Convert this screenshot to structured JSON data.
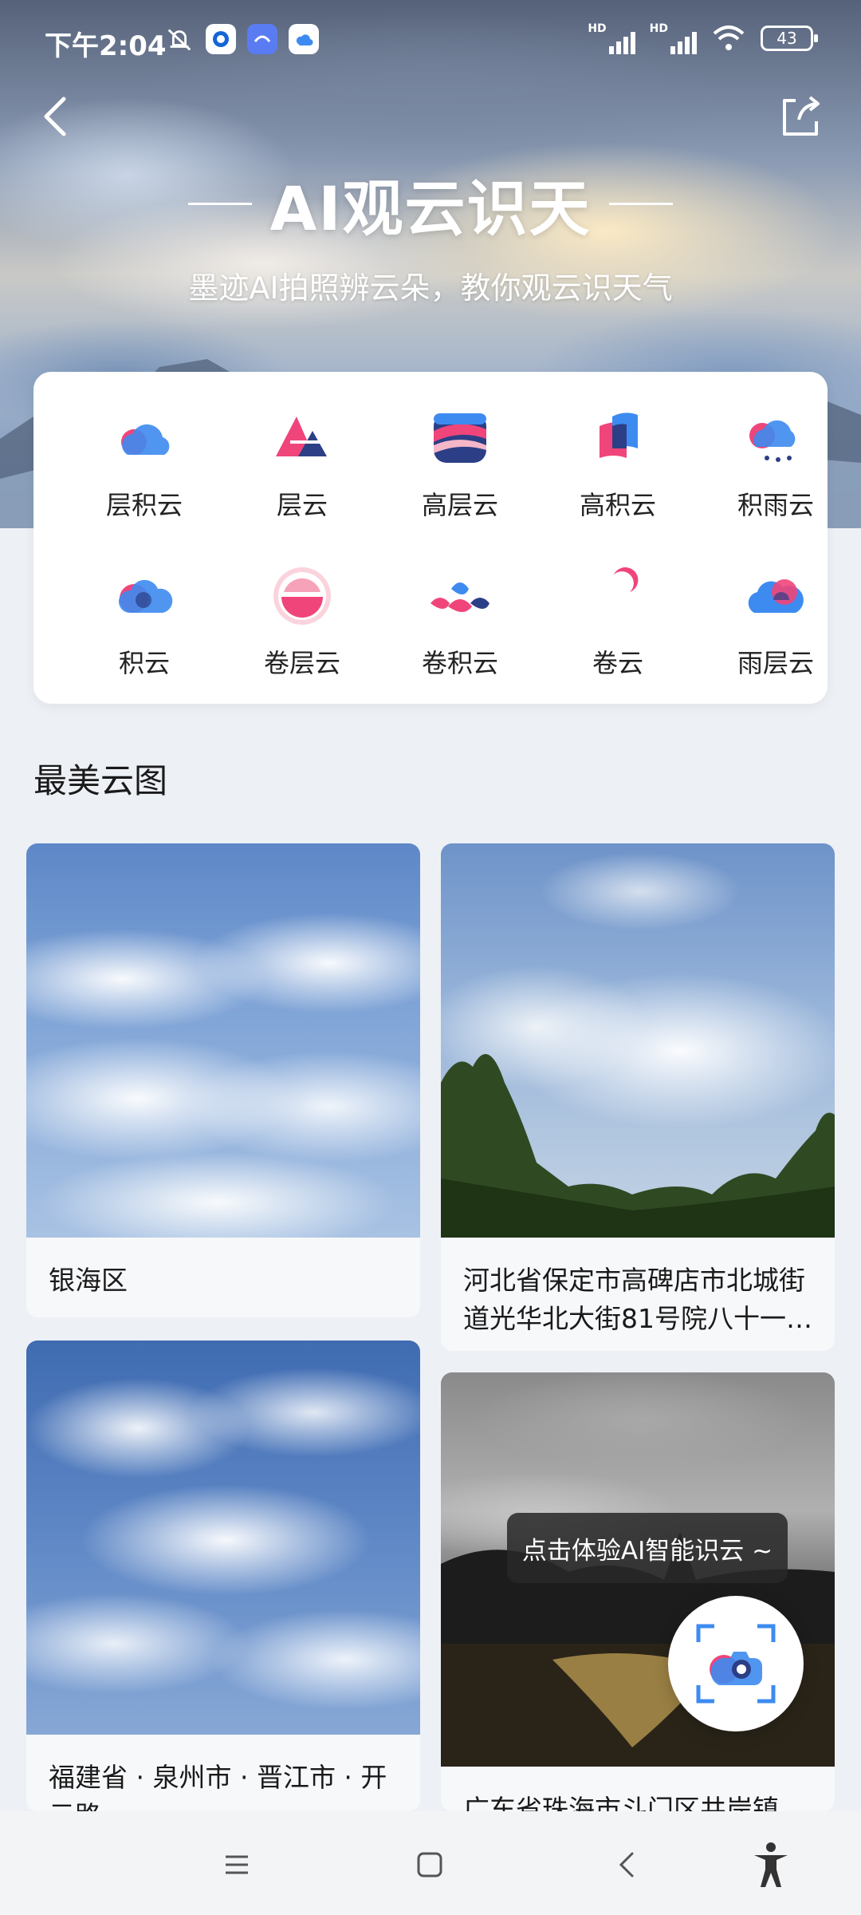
{
  "status_bar": {
    "time": "下午2:04",
    "battery": "43",
    "signal_label_1": "HD",
    "signal_label_2": "HD"
  },
  "header": {
    "title": "AI观云识天",
    "subtitle": "墨迹AI拍照辨云朵，教你观云识天气"
  },
  "cloud_types": [
    {
      "label": "层积云",
      "icon": "stratocumulus-icon"
    },
    {
      "label": "层云",
      "icon": "stratus-icon"
    },
    {
      "label": "高层云",
      "icon": "altostratus-icon"
    },
    {
      "label": "高积云",
      "icon": "altocumulus-icon"
    },
    {
      "label": "积雨云",
      "icon": "cumulonimbus-icon"
    },
    {
      "label": "积云",
      "icon": "cumulus-icon"
    },
    {
      "label": "卷层云",
      "icon": "cirrostratus-icon"
    },
    {
      "label": "卷积云",
      "icon": "cirrocumulus-icon"
    },
    {
      "label": "卷云",
      "icon": "cirrus-icon"
    },
    {
      "label": "雨层云",
      "icon": "nimbostratus-icon"
    }
  ],
  "gallery": {
    "title": "最美云图",
    "cards": [
      {
        "caption": "银海区"
      },
      {
        "caption": "河北省保定市高碑店市北城街道光华北大街81号院八十一…"
      },
      {
        "caption": "福建省 · 泉州市 · 晋江市 · 开元路"
      },
      {
        "caption": "广东省珠海市斗门区井岸镇"
      }
    ]
  },
  "fab": {
    "tooltip": "点击体验AI智能识云 ~"
  },
  "colors": {
    "accent_pink": "#f0457a",
    "accent_blue": "#3d8bf0",
    "accent_navy": "#2c3f86"
  }
}
